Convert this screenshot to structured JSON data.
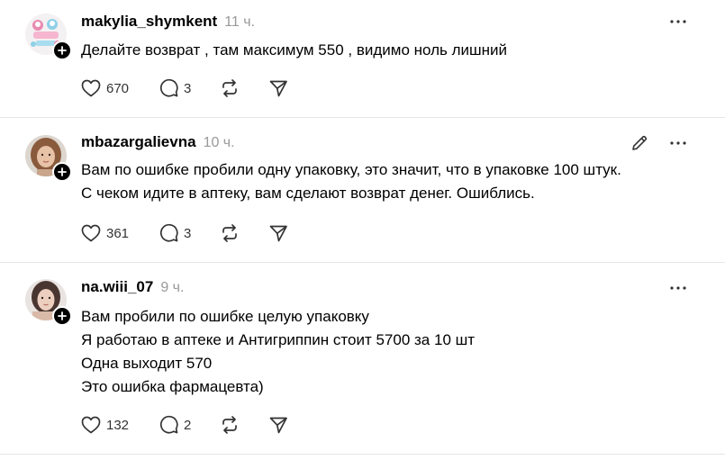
{
  "posts": [
    {
      "username": "makylia_shymkent",
      "time": "11 ч.",
      "lines": [
        "Делайте возврат , там максимум 550 , видимо ноль лишний"
      ],
      "likes": "670",
      "replies": "3",
      "avatar_icon": "cartoon-sticker-avatar",
      "editable": false
    },
    {
      "username": "mbazargalievna",
      "time": "10 ч.",
      "lines": [
        "Вам по ошибке пробили одну упаковку, это значит, что в упаковке 100 штук.",
        "С чеком идите в аптеку, вам сделают возврат денег. Ошиблись."
      ],
      "likes": "361",
      "replies": "3",
      "avatar_icon": "woman-portrait-avatar",
      "editable": true
    },
    {
      "username": "na.wiii_07",
      "time": "9 ч.",
      "lines": [
        "Вам пробили по ошибке целую упаковку",
        "Я работаю в аптеке и Антигриппин стоит 5700 за 10 шт",
        "Одна выходит 570",
        "Это ошибка фармацевта)"
      ],
      "likes": "132",
      "replies": "2",
      "avatar_icon": "woman-portrait-avatar",
      "editable": false
    }
  ],
  "colors": {
    "text": "#000000",
    "muted": "#999999",
    "icon": "#333333",
    "separator": "#e6e6e6"
  },
  "icons": [
    "heart-icon",
    "comment-icon",
    "repost-icon",
    "share-icon",
    "more-icon",
    "edit-icon",
    "plus-icon"
  ]
}
